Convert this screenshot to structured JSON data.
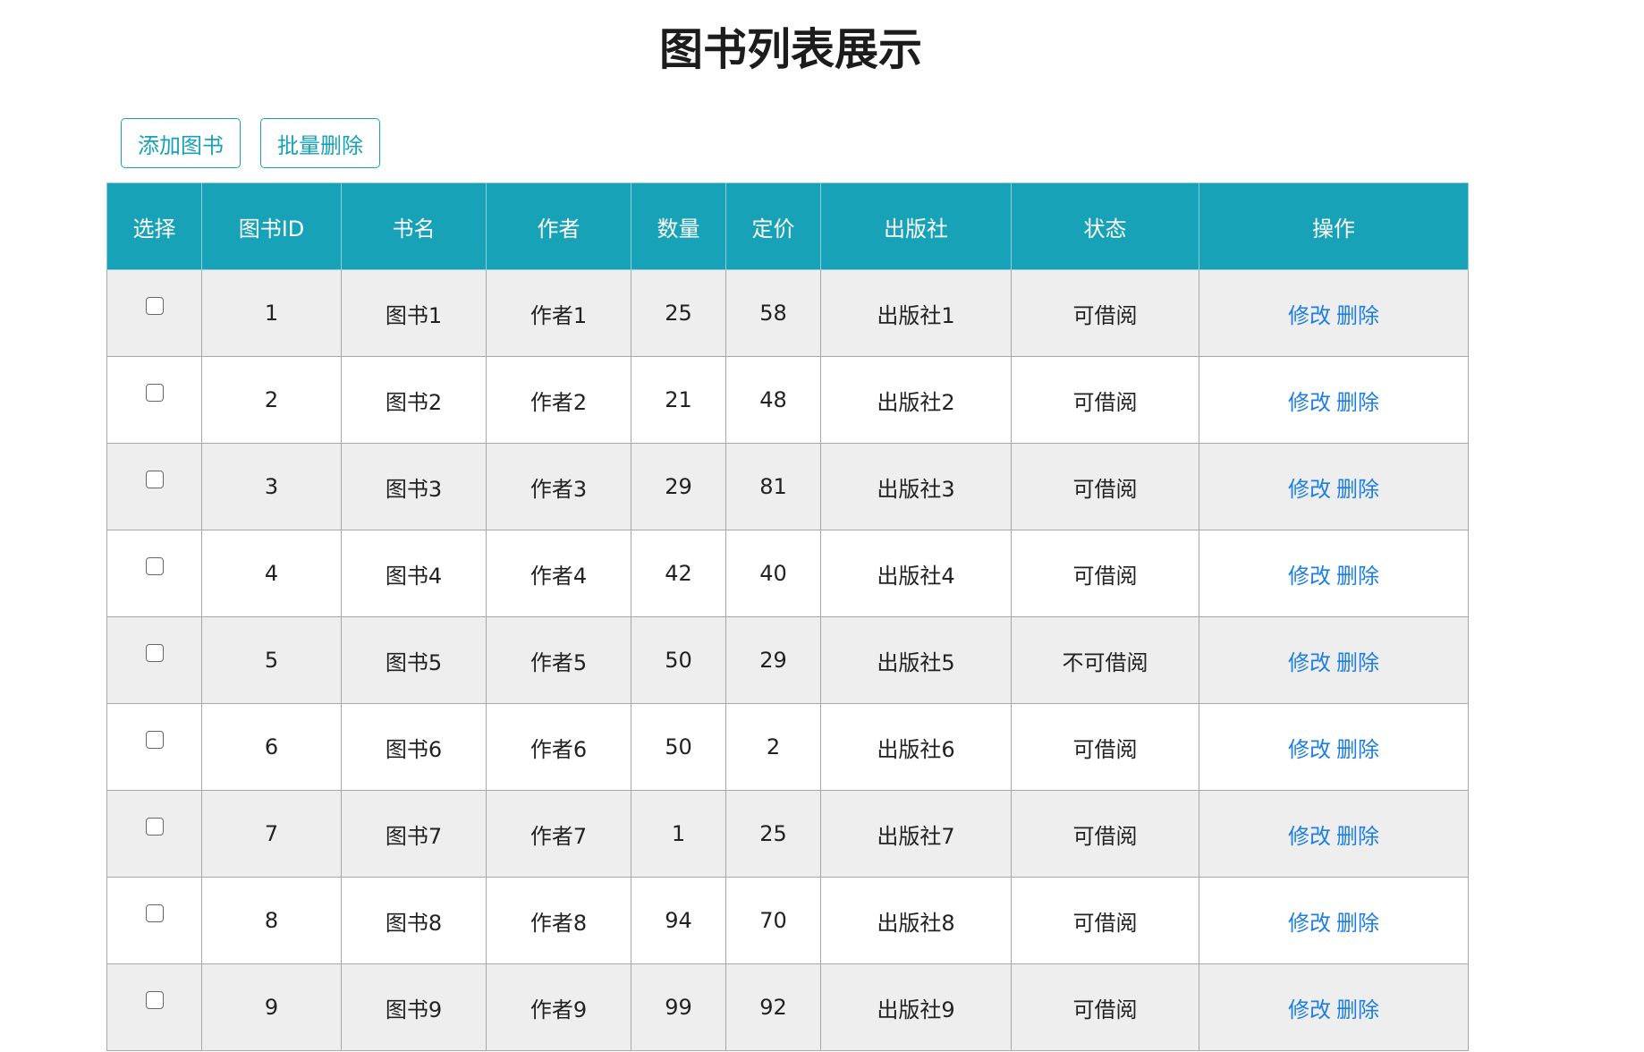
{
  "page": {
    "title": "图书列表展示"
  },
  "toolbar": {
    "add_label": "添加图书",
    "batch_delete_label": "批量删除"
  },
  "table": {
    "headers": [
      "选择",
      "图书ID",
      "书名",
      "作者",
      "数量",
      "定价",
      "出版社",
      "状态",
      "操作"
    ],
    "edit_label": "修改",
    "delete_label": "删除",
    "rows": [
      {
        "id": "1",
        "name": "图书1",
        "author": "作者1",
        "count": "25",
        "price": "58",
        "publisher": "出版社1",
        "status": "可借阅"
      },
      {
        "id": "2",
        "name": "图书2",
        "author": "作者2",
        "count": "21",
        "price": "48",
        "publisher": "出版社2",
        "status": "可借阅"
      },
      {
        "id": "3",
        "name": "图书3",
        "author": "作者3",
        "count": "29",
        "price": "81",
        "publisher": "出版社3",
        "status": "可借阅"
      },
      {
        "id": "4",
        "name": "图书4",
        "author": "作者4",
        "count": "42",
        "price": "40",
        "publisher": "出版社4",
        "status": "可借阅"
      },
      {
        "id": "5",
        "name": "图书5",
        "author": "作者5",
        "count": "50",
        "price": "29",
        "publisher": "出版社5",
        "status": "不可借阅"
      },
      {
        "id": "6",
        "name": "图书6",
        "author": "作者6",
        "count": "50",
        "price": "2",
        "publisher": "出版社6",
        "status": "可借阅"
      },
      {
        "id": "7",
        "name": "图书7",
        "author": "作者7",
        "count": "1",
        "price": "25",
        "publisher": "出版社7",
        "status": "可借阅"
      },
      {
        "id": "8",
        "name": "图书8",
        "author": "作者8",
        "count": "94",
        "price": "70",
        "publisher": "出版社8",
        "status": "可借阅"
      },
      {
        "id": "9",
        "name": "图书9",
        "author": "作者9",
        "count": "99",
        "price": "92",
        "publisher": "出版社9",
        "status": "可借阅"
      }
    ]
  }
}
